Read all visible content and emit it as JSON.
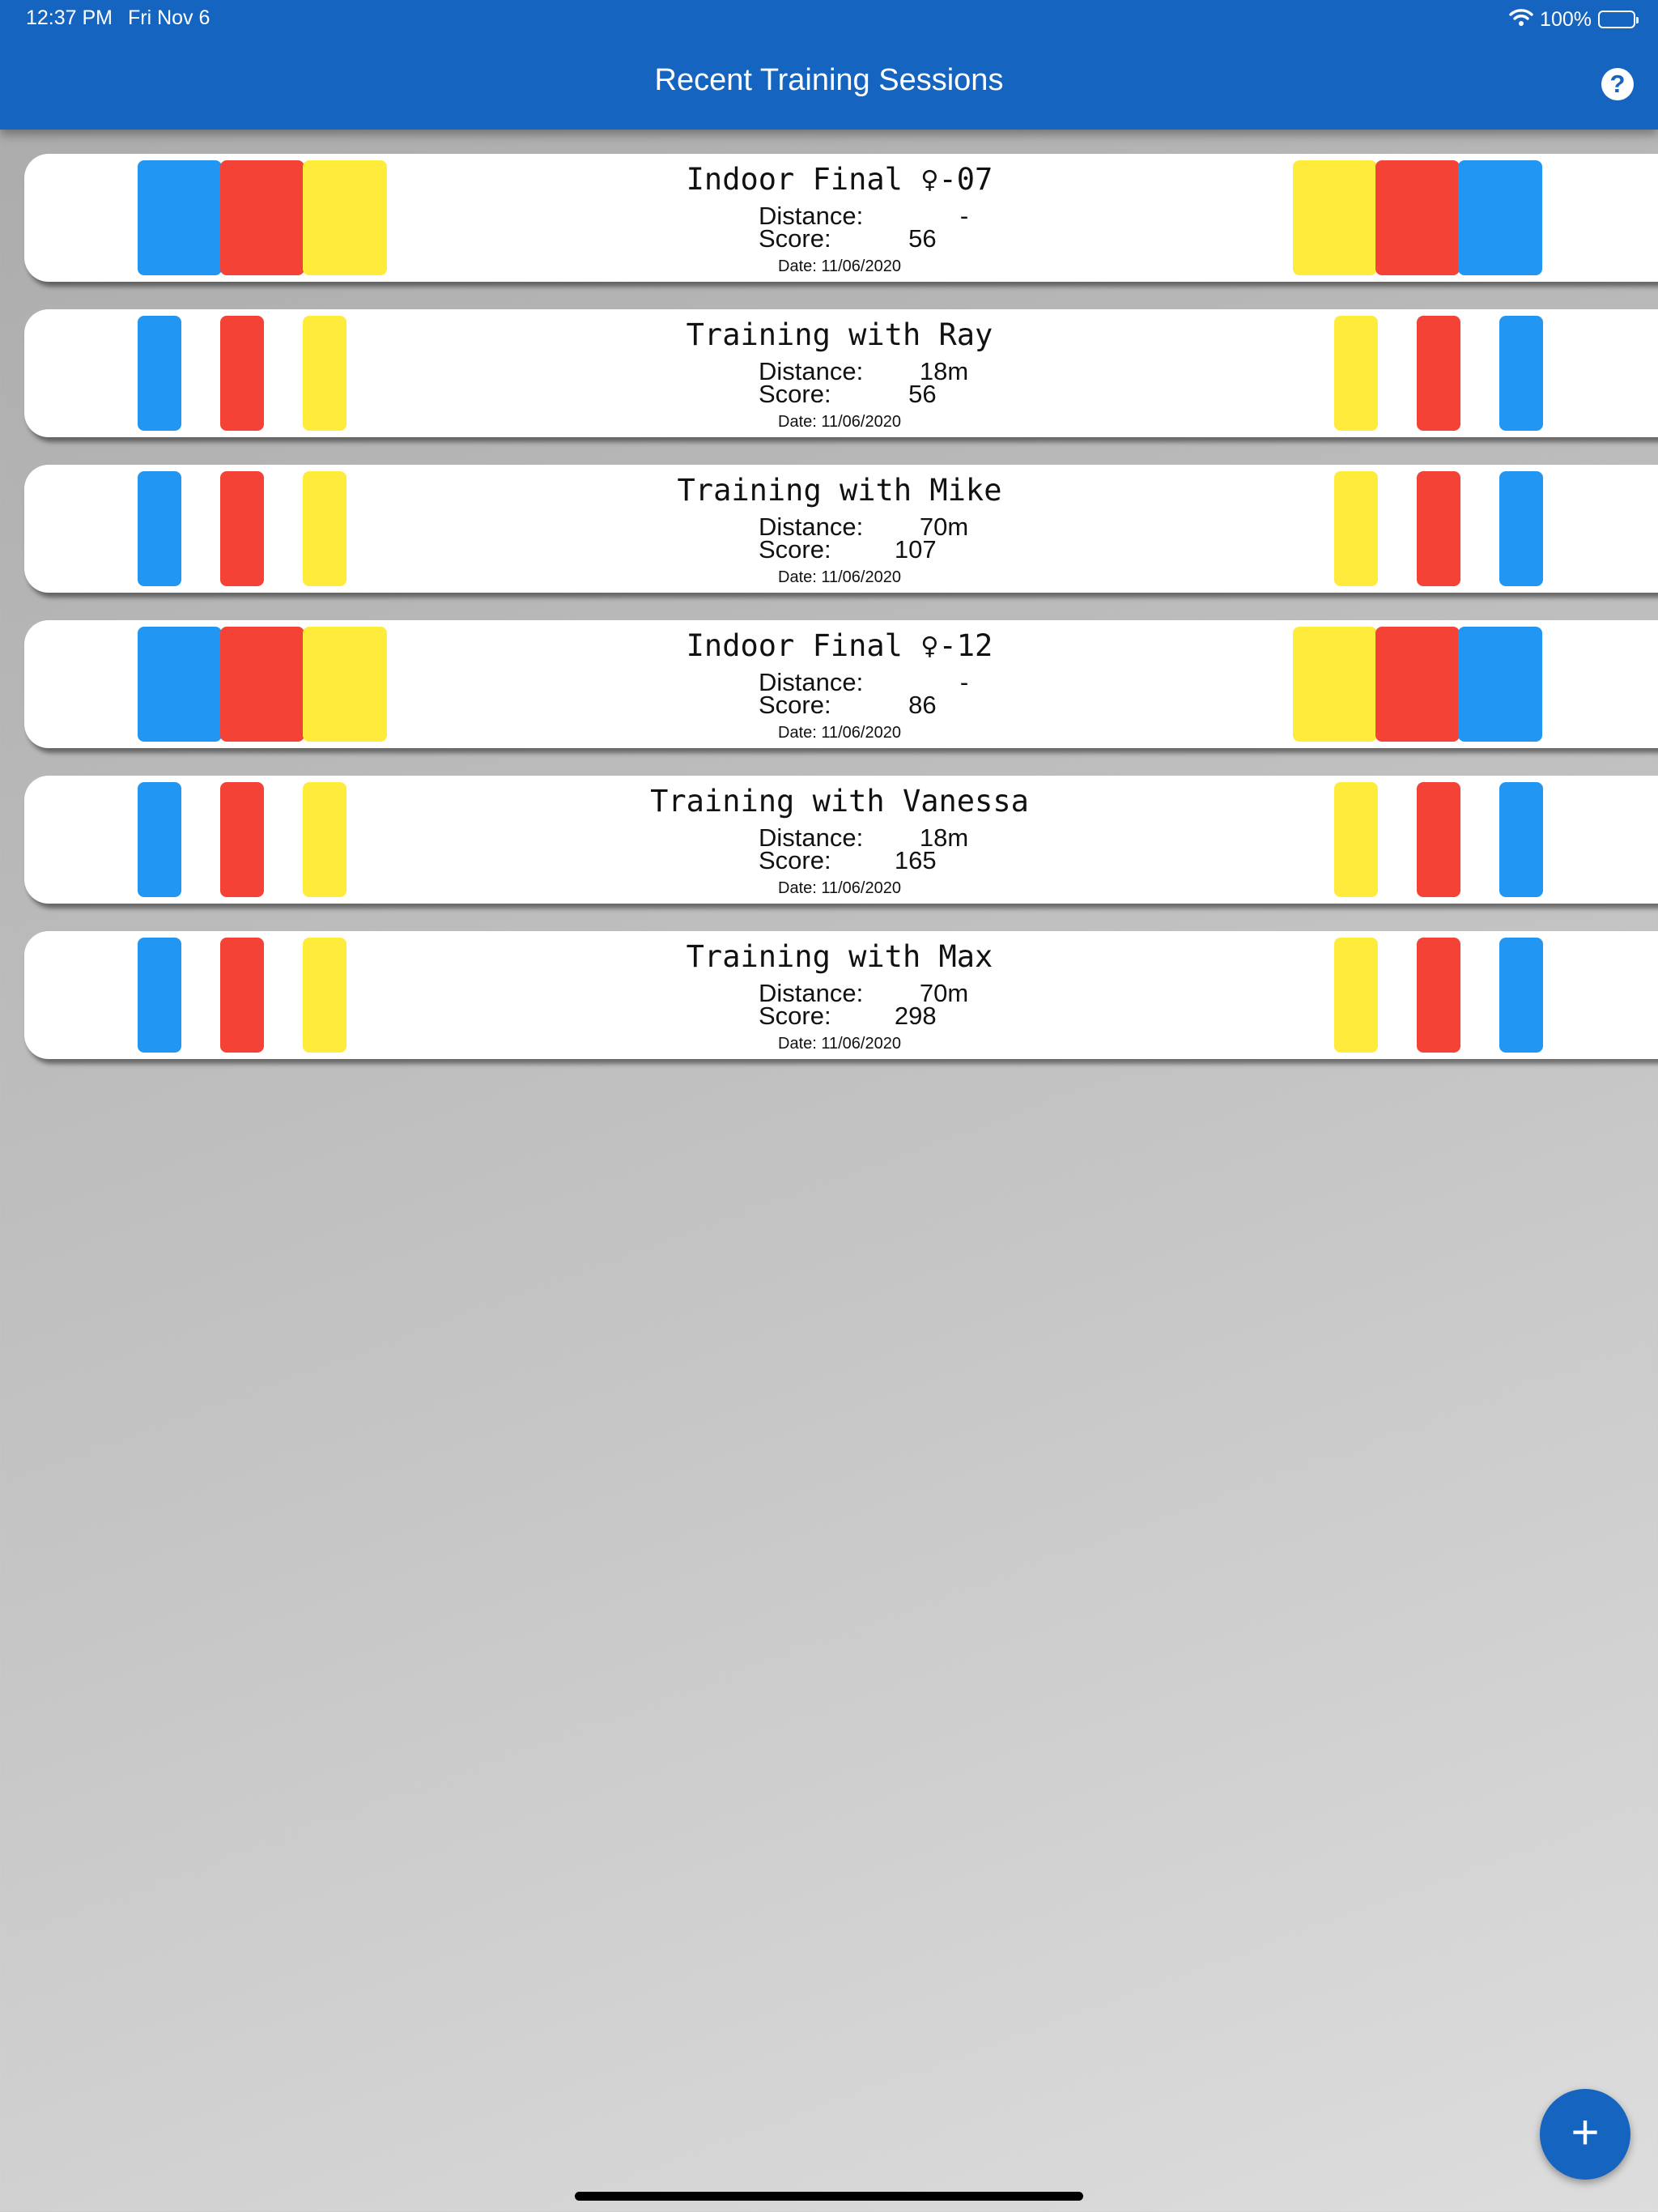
{
  "status_bar": {
    "time": "12:37 PM",
    "day": "Fri Nov 6",
    "battery": "100%"
  },
  "header": {
    "title": "Recent Training Sessions",
    "help_label": "?"
  },
  "labels": {
    "distance": "Distance:",
    "score": "Score:"
  },
  "colors": {
    "appbar": "#1565c0",
    "blue": "#2196f3",
    "red": "#f44336",
    "yellow": "#ffeb3b"
  },
  "sessions": [
    {
      "title": "Indoor Final ♀-07",
      "distance": "-",
      "score": "56",
      "date": "Date: 11/06/2020",
      "style": "wide"
    },
    {
      "title": "Training with Ray",
      "distance": "18m",
      "score": "56",
      "date": "Date: 11/06/2020",
      "style": "narrow"
    },
    {
      "title": "Training with Mike",
      "distance": "70m",
      "score": "107",
      "date": "Date: 11/06/2020",
      "style": "narrow"
    },
    {
      "title": "Indoor Final ♀-12",
      "distance": "-",
      "score": "86",
      "date": "Date: 11/06/2020",
      "style": "wide"
    },
    {
      "title": "Training with Vanessa",
      "distance": "18m",
      "score": "165",
      "date": "Date: 11/06/2020",
      "style": "narrow"
    },
    {
      "title": "Training with Max",
      "distance": "70m",
      "score": "298",
      "date": "Date: 11/06/2020",
      "style": "narrow"
    }
  ],
  "fab": {
    "label": "+"
  }
}
